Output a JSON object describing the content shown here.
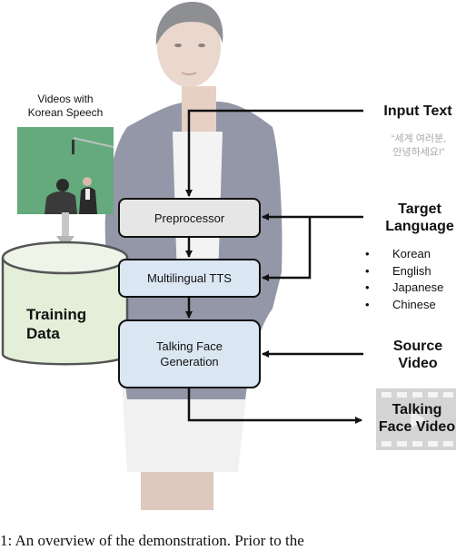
{
  "source_videos": {
    "label_line1": "Videos with",
    "label_line2": "Korean Speech"
  },
  "training_data": {
    "label_line1": "Training",
    "label_line2": "Data"
  },
  "pipeline": {
    "preprocessor": "Preprocessor",
    "tts": "Multilingual TTS",
    "face_gen_line1": "Talking Face",
    "face_gen_line2": "Generation"
  },
  "inputs": {
    "input_text_title": "Input Text",
    "input_text_example_line1": "“세계 여러분,",
    "input_text_example_line2": "안녕하세요!”",
    "target_language_line1": "Target",
    "target_language_line2": "Language",
    "languages": [
      "Korean",
      "English",
      "Japanese",
      "Chinese"
    ],
    "source_video_line1": "Source",
    "source_video_line2": "Video"
  },
  "output": {
    "label_line1": "Talking",
    "label_line2": "Face Video",
    "icon": "film-strip-icon"
  },
  "caption": "1: An overview of the demonstration. Prior to the",
  "colors": {
    "preprocessor_fill": "#e6e6e6",
    "module_fill": "#dbe6f3",
    "database_fill": "#e3efd9",
    "stroke": "#111111",
    "korean_text": "#a9a9a9"
  }
}
